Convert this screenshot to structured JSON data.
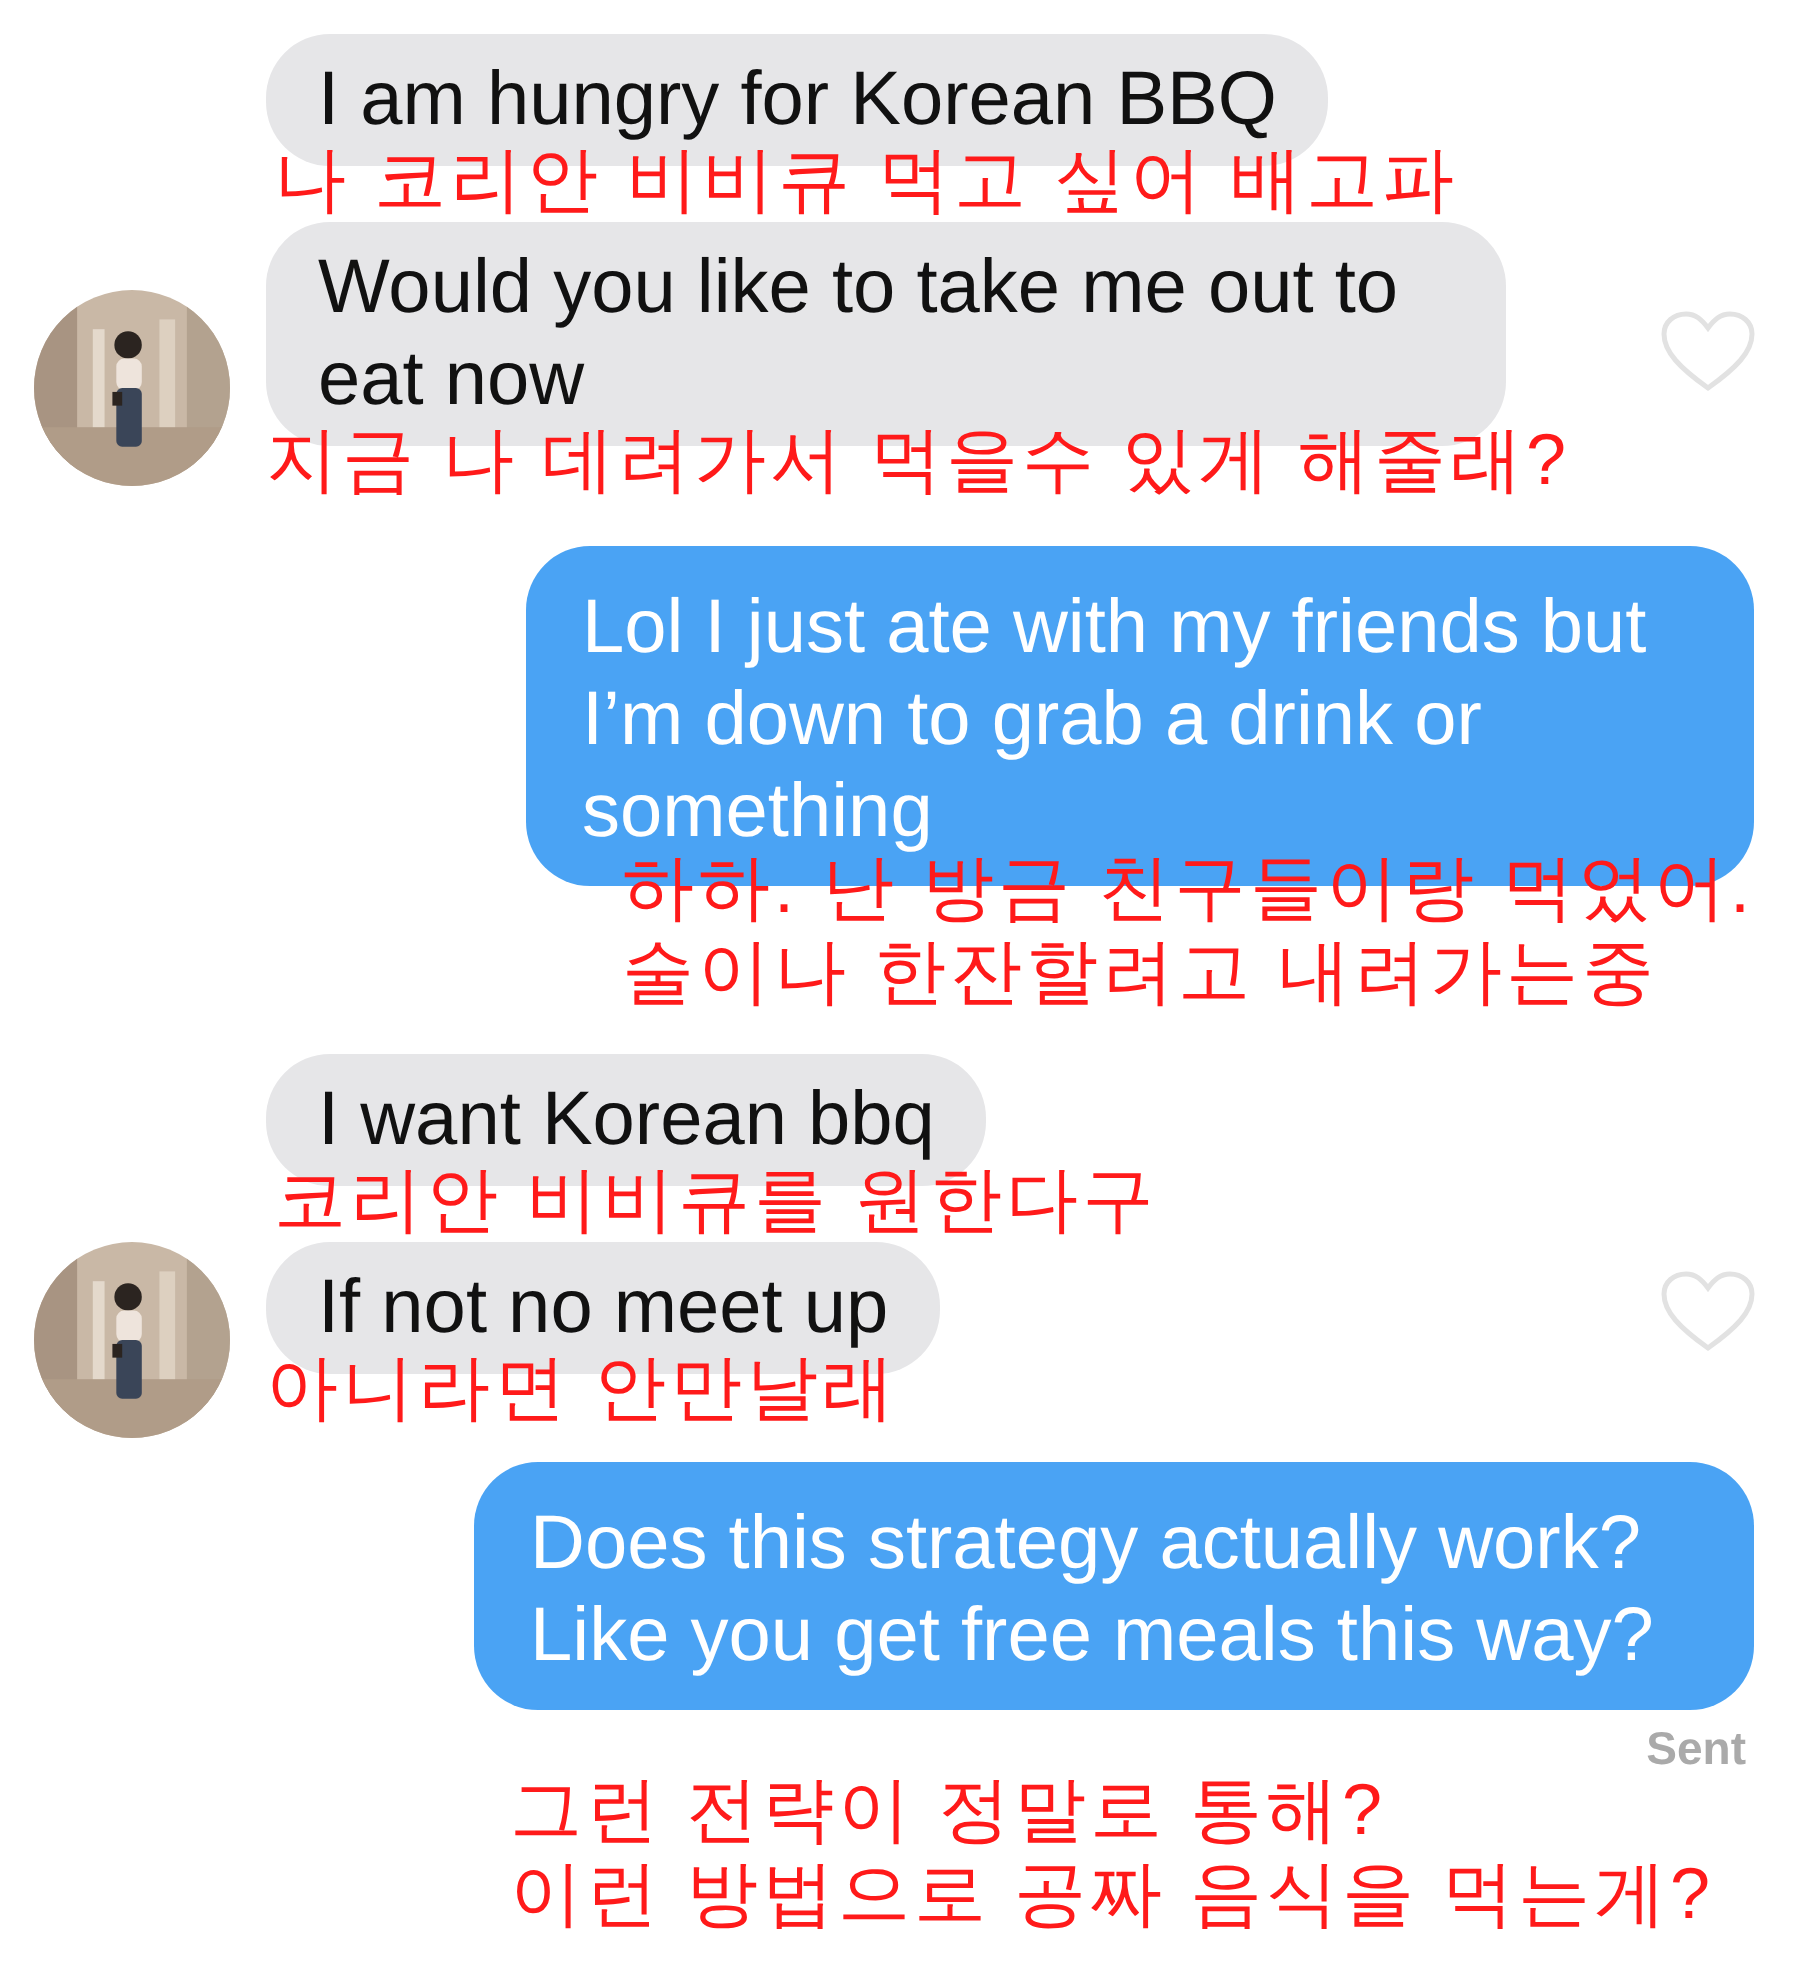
{
  "messages": [
    {
      "kind": "received",
      "liked": false,
      "bubbles": [
        {
          "text": "I am hungry for Korean BBQ",
          "translation": [
            "나 코리안 비비큐 먹고 싶어 배고파"
          ]
        },
        {
          "text": "Would you like to take me out to eat now",
          "translation": [
            "지금 나 데려가서 먹을수 있게 해줄래?"
          ]
        }
      ]
    },
    {
      "kind": "sent",
      "bubbles": [
        {
          "text": "Lol I just ate with my friends but I’m down to grab a drink or something",
          "translation": [
            "하하. 난 방금 친구들이랑 먹었어.",
            "술이나 한잔할려고 내려가는중"
          ]
        }
      ]
    },
    {
      "kind": "received",
      "liked": false,
      "bubbles": [
        {
          "text": "I want Korean bbq",
          "translation": [
            "코리안 비비큐를 원한다구"
          ]
        },
        {
          "text": "If not no meet up",
          "translation": [
            "아니라면 안만날래"
          ]
        }
      ]
    },
    {
      "kind": "sent",
      "status": "Sent",
      "bubbles": [
        {
          "text": "Does this strategy actually work? Like you get free meals this way?",
          "translation": [
            "그런 전략이 정말로 통해?",
            "이런 방법으로 공짜 음식을 먹는게?"
          ]
        }
      ]
    }
  ]
}
